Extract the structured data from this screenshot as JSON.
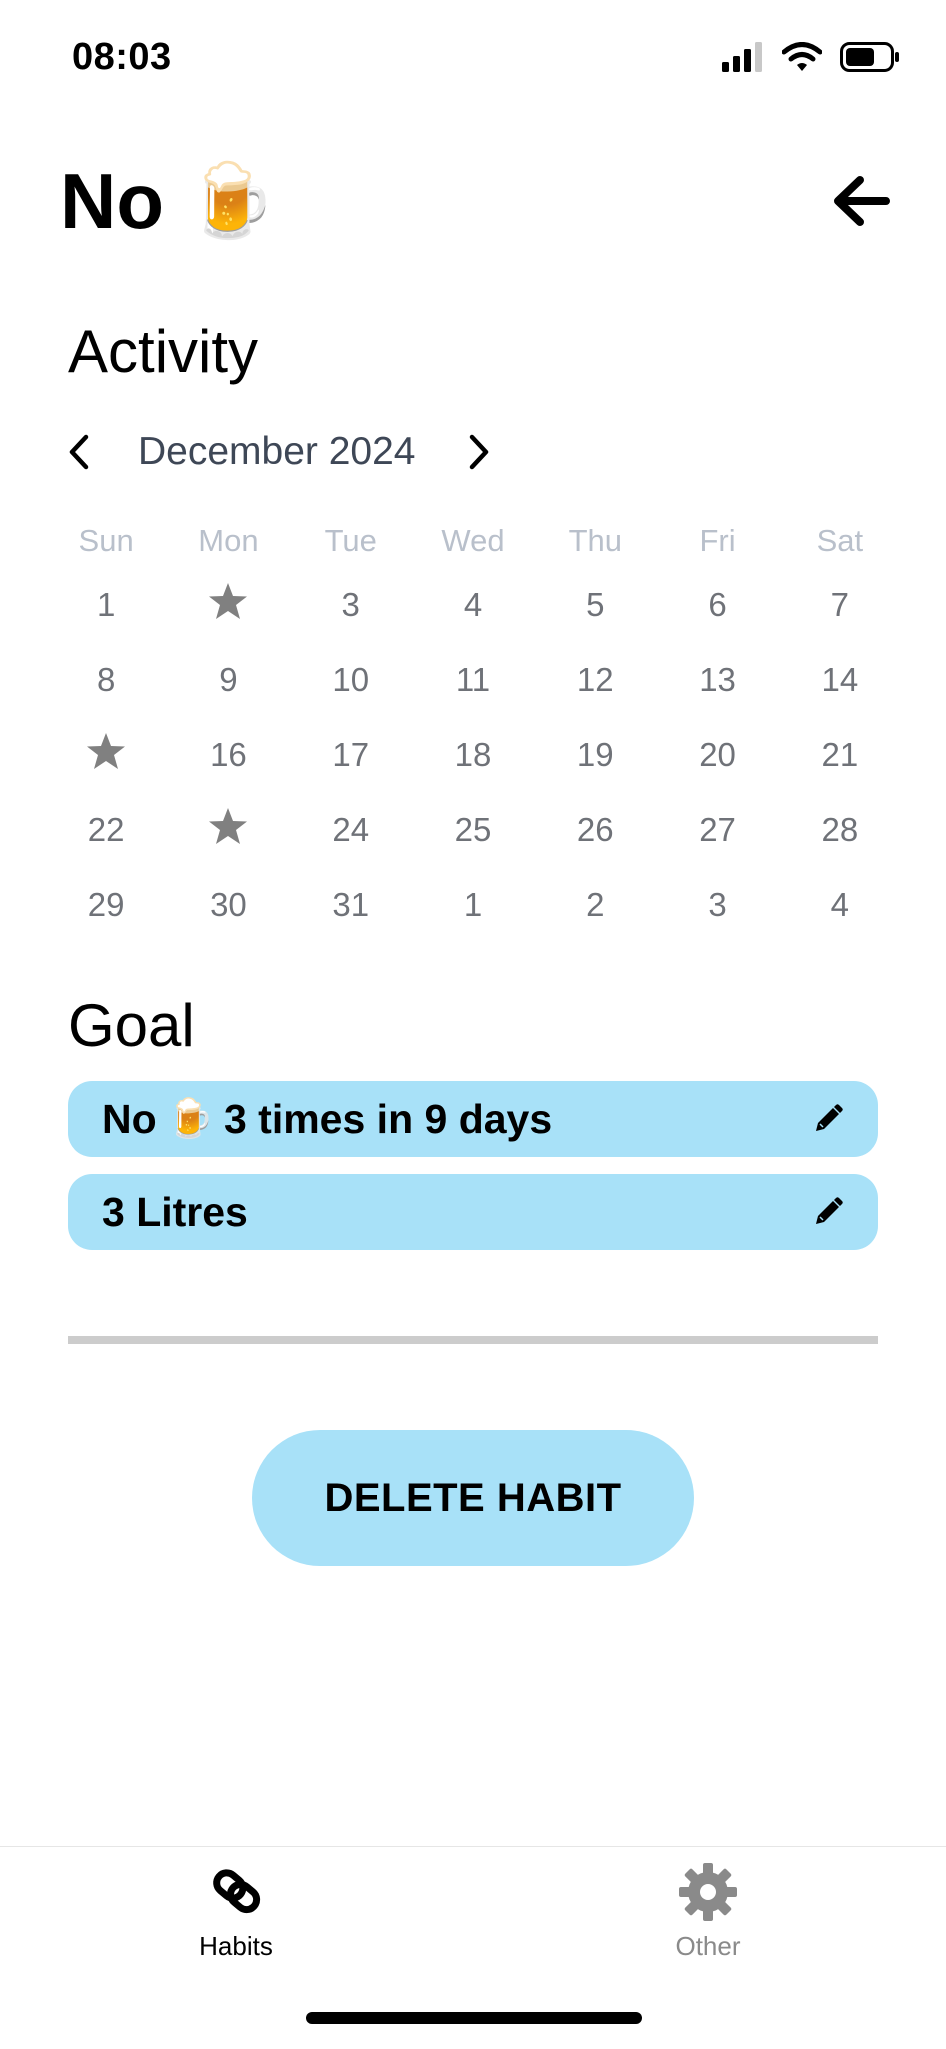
{
  "status_bar": {
    "time": "08:03"
  },
  "header": {
    "title_text": "No",
    "title_emoji": "🍺"
  },
  "activity": {
    "title": "Activity",
    "month_label": "December 2024",
    "weekdays": [
      "Sun",
      "Mon",
      "Tue",
      "Wed",
      "Thu",
      "Fri",
      "Sat"
    ],
    "weeks": [
      [
        "1",
        "★",
        "3",
        "4",
        "5",
        "6",
        "7"
      ],
      [
        "8",
        "9",
        "10",
        "11",
        "12",
        "13",
        "14"
      ],
      [
        "★",
        "16",
        "17",
        "18",
        "19",
        "20",
        "21"
      ],
      [
        "22",
        "★",
        "24",
        "25",
        "26",
        "27",
        "28"
      ],
      [
        "29",
        "30",
        "31",
        "1",
        "2",
        "3",
        "4"
      ]
    ]
  },
  "goal": {
    "title": "Goal",
    "card1": {
      "prefix": "No",
      "emoji": "🍺",
      "suffix": "3 times in 9 days"
    },
    "card2": {
      "text": "3 Litres"
    }
  },
  "actions": {
    "delete_label": "DELETE HABIT"
  },
  "tabbar": {
    "habits_label": "Habits",
    "other_label": "Other"
  },
  "colors": {
    "accent": "#a8e1f8",
    "weekday": "#b9c0cb",
    "day": "#6f7278",
    "star": "#808080",
    "divider": "#cccccc"
  }
}
